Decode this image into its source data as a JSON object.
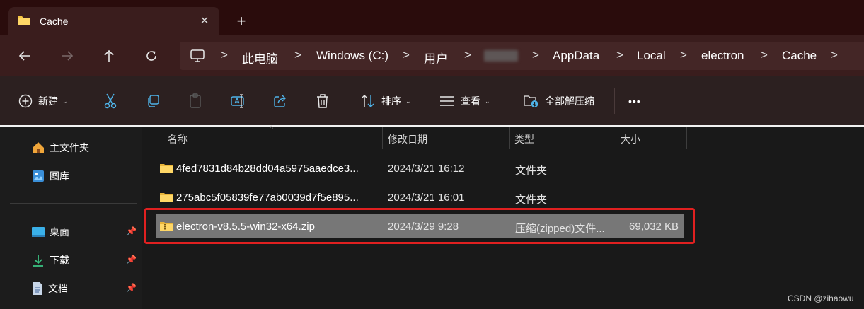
{
  "tab": {
    "title": "Cache",
    "close": "✕",
    "new_tab": "+"
  },
  "nav": {
    "breadcrumbs": [
      "此电脑",
      "Windows (C:)",
      "用户",
      "AppData",
      "Local",
      "electron",
      "Cache"
    ],
    "separator": ">"
  },
  "toolbar": {
    "new_label": "新建",
    "sort_label": "排序",
    "view_label": "查看",
    "extract_label": "全部解压缩",
    "more_label": "•••"
  },
  "sidebar": {
    "items": [
      {
        "label": "主文件夹",
        "icon": "home-icon"
      },
      {
        "label": "图库",
        "icon": "gallery-icon"
      },
      {
        "label": "桌面",
        "icon": "desktop-icon",
        "pinned": true
      },
      {
        "label": "下载",
        "icon": "download-icon",
        "pinned": true
      },
      {
        "label": "文档",
        "icon": "document-icon",
        "pinned": true
      }
    ]
  },
  "columns": {
    "name": "名称",
    "date": "修改日期",
    "type": "类型",
    "size": "大小"
  },
  "files": [
    {
      "name": "4fed7831d84b28dd04a5975aaedce3...",
      "date": "2024/3/21 16:12",
      "type": "文件夹",
      "size": "",
      "icon": "folder-icon"
    },
    {
      "name": "275abc5f05839fe77ab0039d7f5e895...",
      "date": "2024/3/21 16:01",
      "type": "文件夹",
      "size": "",
      "icon": "folder-icon"
    },
    {
      "name": "electron-v8.5.5-win32-x64.zip",
      "date": "2024/3/29 9:28",
      "type": "压缩(zipped)文件...",
      "size": "69,032 KB",
      "icon": "zip-folder-icon",
      "selected": true
    }
  ],
  "watermark": "CSDN @zihaowu",
  "colors": {
    "titlebar": "#2a0c0c",
    "navbar": "#3a1d1d",
    "selection": "#777777",
    "highlight": "#e02020",
    "folder": "#f5c542"
  }
}
